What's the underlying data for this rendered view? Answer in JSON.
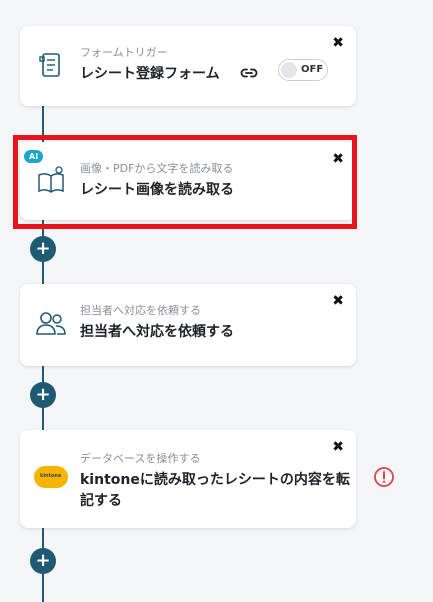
{
  "steps": [
    {
      "subtitle": "フォームトリガー",
      "title": "レシート登録フォーム",
      "icon": "form-trigger-icon",
      "toggle_label": "OFF",
      "toggle_on": false
    },
    {
      "badge": "AI",
      "subtitle": "画像・PDFから文字を読み取る",
      "title": "レシート画像を読み取る",
      "icon": "book-read-icon",
      "highlight_color": "#e8141b"
    },
    {
      "subtitle": "担当者へ対応を依頼する",
      "title": "担当者へ対応を依頼する",
      "icon": "people-icon"
    },
    {
      "subtitle": "データベースを操作する",
      "title": "kintoneに読み取ったレシートの内容を転記する",
      "icon": "kintone-icon",
      "logo_text": "kintone",
      "warning_icon": "alert-circle-icon"
    }
  ],
  "add_button_symbol": "+",
  "close_symbol": "✖",
  "colors": {
    "accent": "#1f5a74",
    "ai_badge": "#18a6c9",
    "warning": "#e0454f"
  }
}
